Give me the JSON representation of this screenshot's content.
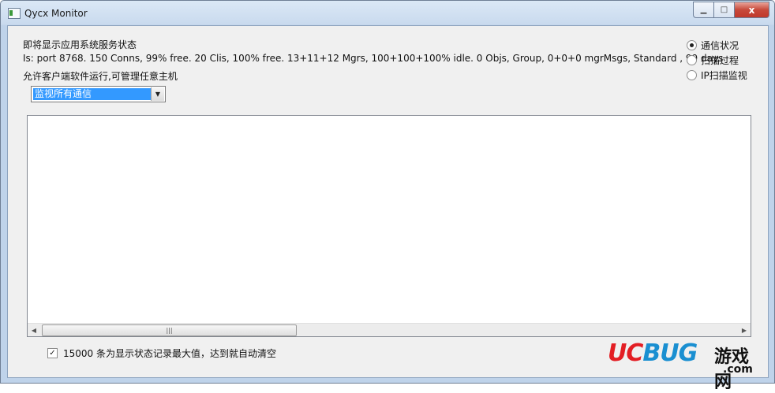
{
  "window": {
    "title": "Qycx Monitor"
  },
  "caption_buttons": {
    "minimize": "▁",
    "maximize": "□",
    "close": "x"
  },
  "status": {
    "heading": "即将显示应用系统服务状态",
    "info": "Is: port 8768. 150 Conns, 99% free. 20 Clis, 100% free. 13+11+12 Mgrs, 100+100+100% idle. 0 Objs, Group, 0+0+0 mgrMsgs, Standard , 99 days",
    "permission": "允许客户端软件运行,可管理任意主机"
  },
  "filter": {
    "selected": "监视所有通信"
  },
  "view_mode": {
    "options": [
      {
        "label": "通信状况",
        "checked": true
      },
      {
        "label": "扫描过程",
        "checked": false
      },
      {
        "label": "IP扫描监视",
        "checked": false
      }
    ]
  },
  "list": {
    "items": [],
    "scroll_thumb_fraction": 0.35
  },
  "auto_clear": {
    "checked": true,
    "label": "15000 条为显示状态记录最大值，达到就自动清空"
  },
  "watermark": {
    "uc": "UC",
    "bug": "BUG",
    "cn": "游戏网",
    "com": ".com"
  },
  "icons": [
    "app-icon",
    "minimize-icon",
    "maximize-icon",
    "close-icon",
    "dropdown-arrow-icon",
    "scroll-left-icon",
    "scroll-right-icon"
  ]
}
